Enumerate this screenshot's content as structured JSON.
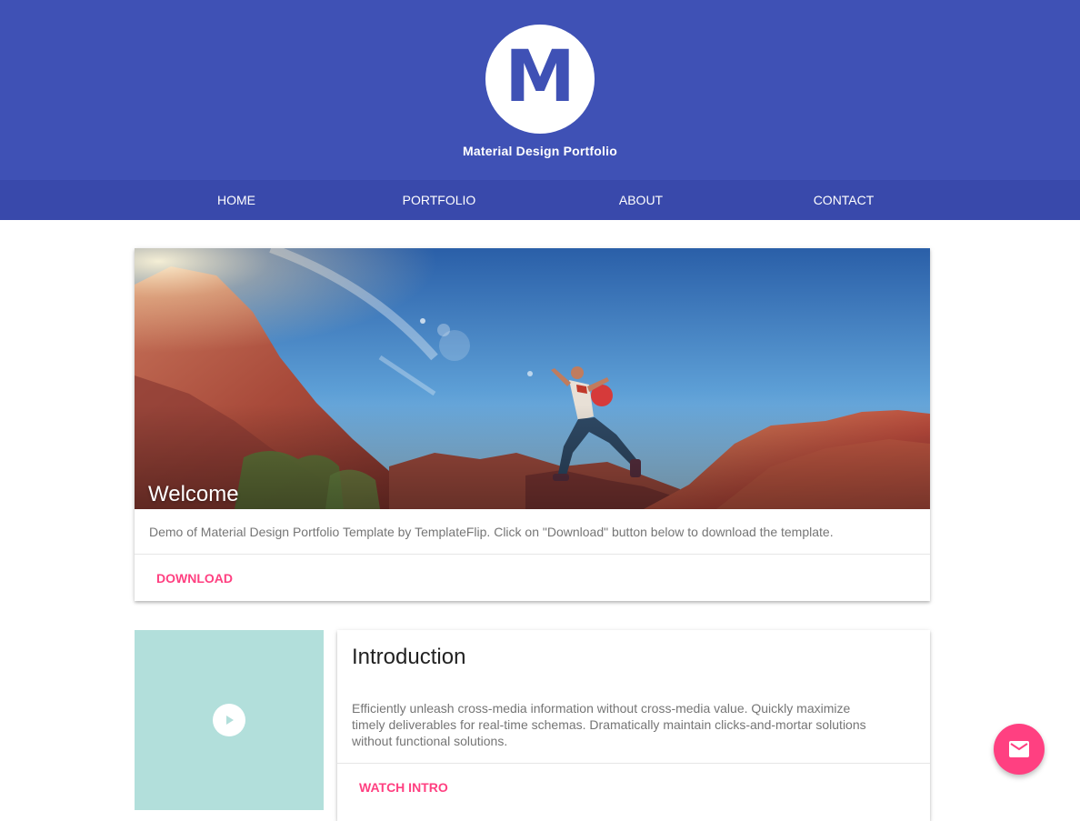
{
  "header": {
    "logo_letter": "M",
    "site_title": "Material Design Portfolio",
    "colors": {
      "primary": "#3f51b5",
      "nav": "#3949ab",
      "accent": "#ff4081"
    }
  },
  "nav": {
    "items": [
      {
        "label": "HOME"
      },
      {
        "label": "PORTFOLIO"
      },
      {
        "label": "ABOUT"
      },
      {
        "label": "CONTACT"
      }
    ]
  },
  "welcome_card": {
    "title": "Welcome",
    "image": "photo of a hiker leaping between red rock cliffs under a blue sky",
    "description": "Demo of Material Design Portfolio Template by TemplateFlip. Click on \"Download\" button below to download the template.",
    "action_label": "DOWNLOAD"
  },
  "intro_card": {
    "video_icon": "play-icon",
    "title": "Introduction",
    "description": "Efficiently unleash cross-media information without cross-media value. Quickly maximize timely deliverables for real-time schemas. Dramatically maintain clicks-and-mortar solutions without functional solutions.",
    "action_label": "WATCH INTRO"
  },
  "fab": {
    "icon": "mail-icon"
  }
}
